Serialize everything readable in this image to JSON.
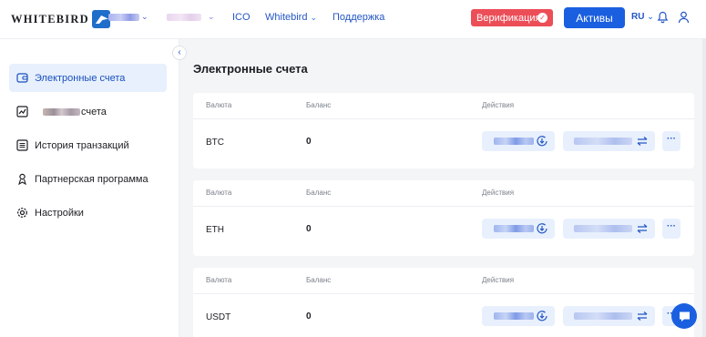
{
  "header": {
    "logo_text": "WHITEBIRD",
    "nav": {
      "ico": "ICO",
      "whitebird": "Whitebird",
      "support": "Поддержка"
    },
    "verify_label": "Верификация",
    "assets_label": "Активы",
    "language": "RU"
  },
  "sidebar": {
    "items": [
      {
        "label": "Электронные счета"
      },
      {
        "label": "счета"
      },
      {
        "label": "История транзакций"
      },
      {
        "label": "Партнерская программа"
      },
      {
        "label": "Настройки"
      }
    ]
  },
  "main": {
    "title": "Электронные счета",
    "columns": {
      "currency": "Валюта",
      "balance": "Баланс",
      "actions": "Действия"
    },
    "more_label": "···",
    "accounts": [
      {
        "currency": "BTC",
        "balance": "0"
      },
      {
        "currency": "ETH",
        "balance": "0"
      },
      {
        "currency": "USDT",
        "balance": "0"
      }
    ]
  },
  "colors": {
    "accent": "#1a5fe0",
    "verify": "#ec4e57",
    "active_bg": "#e7f0fc",
    "action_bg": "#e8f0fd"
  },
  "icons": [
    "wallet-icon",
    "chart-icon",
    "list-icon",
    "partners-icon",
    "gear-icon",
    "bell-icon",
    "user-icon",
    "chat-icon"
  ]
}
